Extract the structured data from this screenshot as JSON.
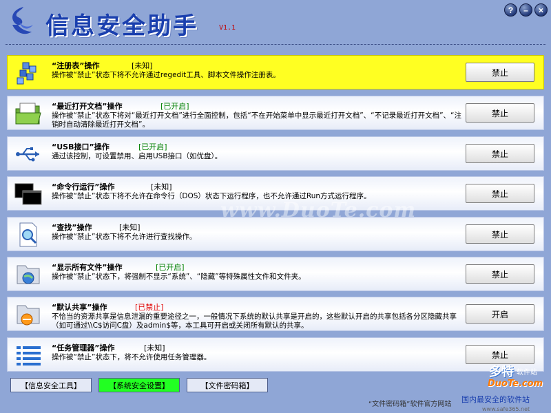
{
  "header": {
    "title": "信息安全助手",
    "version": "V1.1",
    "help_label": "?",
    "min_label": "–",
    "close_label": "×"
  },
  "rows": [
    {
      "icon": "registry-icon",
      "title": "“注册表”操作",
      "status": "[未知]",
      "status_type": "unknown",
      "desc": "操作被“禁止”状态下将不允许通过regedit工具、脚本文件操作注册表。",
      "action": "禁止"
    },
    {
      "icon": "recent-docs-icon",
      "title": "“最近打开文档”操作",
      "status": "[已开启]",
      "status_type": "on",
      "desc": "操作被“禁止”状态下将对“最近打开文档”进行全面控制，包括“不在开始菜单中显示最近打开文档”、“不记录最近打开文档”、“注销时自动清除最近打开文档”。",
      "action": "禁止"
    },
    {
      "icon": "usb-icon",
      "title": "“USB接口”操作",
      "status": "[已开启]",
      "status_type": "on",
      "desc": "通过该控制，可设置禁用、启用USB接口（如优盘）。",
      "action": "禁止"
    },
    {
      "icon": "command-line-icon",
      "title": "“命令行运行”操作",
      "status": "[未知]",
      "status_type": "unknown",
      "desc": "操作被“禁止”状态下将不允许在命令行（DOS）状态下运行程序，也不允许通过Run方式运行程序。",
      "action": "禁止"
    },
    {
      "icon": "search-icon",
      "title": "“查找”操作",
      "status": "[未知]",
      "status_type": "unknown",
      "desc": "操作被“禁止”状态下将不允许进行查找操作。",
      "action": "禁止"
    },
    {
      "icon": "show-files-icon",
      "title": "“显示所有文件”操作",
      "status": "[已开启]",
      "status_type": "on",
      "desc": "操作被“禁止”状态下，将强制不显示“系统”、“隐藏”等特殊属性文件和文件夹。",
      "action": "禁止"
    },
    {
      "icon": "default-share-icon",
      "title": "“默认共享”操作",
      "status": "[已禁止]",
      "status_type": "off",
      "desc": "不恰当的资源共享是信息泄漏的重要途径之一，一般情况下系统的默认共享是开启的，这些默认开启的共享包括各分区隐藏共享（如可通过\\\\C$访问C盘）及admin$等，本工具可开启或关闭所有默认的共享。",
      "action": "开启"
    },
    {
      "icon": "task-manager-icon",
      "title": "“任务管理器”操作",
      "status": "[未知]",
      "status_type": "unknown",
      "desc": "操作被“禁止”状态下，将不允许使用任务管理器。",
      "action": "禁止"
    }
  ],
  "nav": {
    "info_tools": "【信息安全工具】",
    "system_settings": "【系统安全设置】",
    "password_box": "【文件密码箱】"
  },
  "footer": {
    "text": "“文件密码箱”软件官方网站",
    "url": "www.safe365.net"
  },
  "watermark": {
    "center": "www.DuoTe.com",
    "corner_cn": "多特",
    "corner_sub": "软件站",
    "corner_en": "DuoTe.com",
    "corner_slogan": "国内最安全的软件站"
  },
  "colors": {
    "background": "#8fa6d6",
    "selected_row": "#ffff22",
    "status_on": "#008000",
    "status_off": "#e00000",
    "active_nav": "#22ff22"
  }
}
